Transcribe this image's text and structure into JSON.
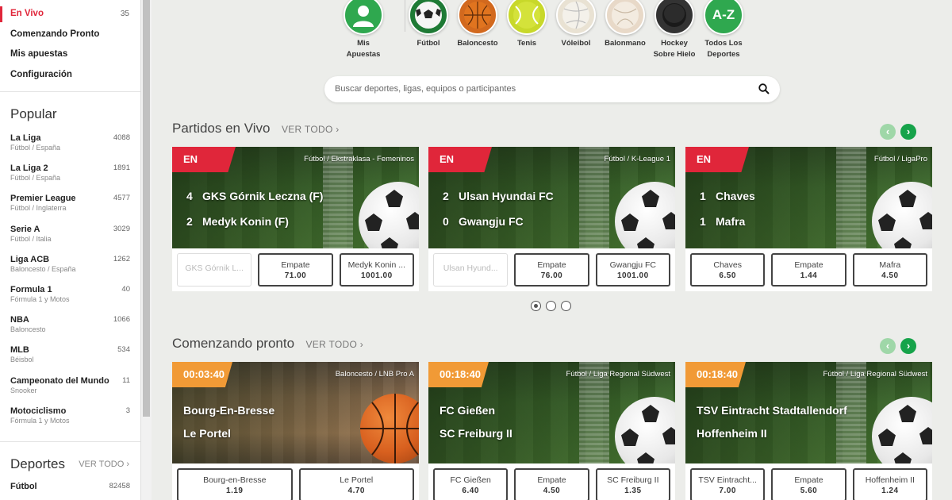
{
  "sidebar": {
    "nav": [
      {
        "label": "En Vivo",
        "count": "35",
        "active": true
      },
      {
        "label": "Comenzando Pronto",
        "count": ""
      },
      {
        "label": "Mis apuestas",
        "count": ""
      },
      {
        "label": "Configuración",
        "count": ""
      }
    ],
    "popular_title": "Popular",
    "popular": [
      {
        "name": "La Liga",
        "sub": "Fútbol / España",
        "count": "4088"
      },
      {
        "name": "La Liga 2",
        "sub": "Fútbol / España",
        "count": "1891"
      },
      {
        "name": "Premier League",
        "sub": "Fútbol / Inglaterra",
        "count": "4577"
      },
      {
        "name": "Serie A",
        "sub": "Fútbol / Italia",
        "count": "3029"
      },
      {
        "name": "Liga ACB",
        "sub": "Baloncesto / España",
        "count": "1262"
      },
      {
        "name": "Formula 1",
        "sub": "Fórmula 1 y Motos",
        "count": "40"
      },
      {
        "name": "NBA",
        "sub": "Baloncesto",
        "count": "1066"
      },
      {
        "name": "MLB",
        "sub": "Béisbol",
        "count": "534"
      },
      {
        "name": "Campeonato del Mundo",
        "sub": "Snooker",
        "count": "11"
      },
      {
        "name": "Motociclismo",
        "sub": "Fórmula 1 y Motos",
        "count": "3"
      }
    ],
    "deportes_title": "Deportes",
    "deportes_vertodo": "VER TODO",
    "deportes": [
      {
        "name": "Fútbol",
        "count": "82458"
      }
    ]
  },
  "sports_bar": [
    {
      "label1": "Mis",
      "label2": "Apuestas",
      "icon": "user-icon",
      "color": "#2fa84f"
    },
    {
      "label1": "Fútbol",
      "label2": "",
      "icon": "soccer-ball-icon",
      "color": "#1e7a35"
    },
    {
      "label1": "Baloncesto",
      "label2": "",
      "icon": "basketball-icon",
      "color": "#d2691e"
    },
    {
      "label1": "Tenis",
      "label2": "",
      "icon": "tennis-ball-icon",
      "color": "#c8d82a"
    },
    {
      "label1": "Vóleibol",
      "label2": "",
      "icon": "volleyball-icon",
      "color": "#e9e2d3"
    },
    {
      "label1": "Balonmano",
      "label2": "",
      "icon": "handball-icon",
      "color": "#e8d9c8"
    },
    {
      "label1": "Hockey",
      "label2": "Sobre Hielo",
      "icon": "hockey-puck-icon",
      "color": "#333333"
    },
    {
      "label1": "Todos Los",
      "label2": "Deportes",
      "icon": "a-z-icon",
      "icon_text": "A-Z",
      "color": "#2fa84f"
    }
  ],
  "search": {
    "placeholder": "Buscar deportes, ligas, equipos o participantes"
  },
  "live_section": {
    "title": "Partidos en Vivo",
    "vertodo": "VER TODO",
    "cards": [
      {
        "badge": "EN VIVO",
        "league": "Fútbol / Ekstraklasa - Femeninos",
        "team1": "GKS Górnik Leczna (F)",
        "score1": "4",
        "team2": "Medyk Konin (F)",
        "score2": "2",
        "odds": [
          {
            "label": "GKS Górnik L...",
            "value": "",
            "disabled": true
          },
          {
            "label": "Empate",
            "value": "71.00"
          },
          {
            "label": "Medyk Konin ...",
            "value": "1001.00"
          }
        ]
      },
      {
        "badge": "EN VIVO",
        "league": "Fútbol / K-League 1",
        "team1": "Ulsan Hyundai FC",
        "score1": "2",
        "team2": "Gwangju FC",
        "score2": "0",
        "odds": [
          {
            "label": "Ulsan Hyund...",
            "value": "",
            "disabled": true
          },
          {
            "label": "Empate",
            "value": "76.00"
          },
          {
            "label": "Gwangju FC",
            "value": "1001.00"
          }
        ]
      },
      {
        "badge": "EN VIVO",
        "league": "Fútbol / LigaPro",
        "team1": "Chaves",
        "score1": "1",
        "team2": "Mafra",
        "score2": "1",
        "odds": [
          {
            "label": "Chaves",
            "value": "6.50"
          },
          {
            "label": "Empate",
            "value": "1.44"
          },
          {
            "label": "Mafra",
            "value": "4.50"
          }
        ]
      }
    ]
  },
  "soon_section": {
    "title": "Comenzando pronto",
    "vertodo": "VER TODO",
    "cards": [
      {
        "badge": "00:03:40",
        "league": "Baloncesto / LNB Pro A",
        "team1": "Bourg-En-Bresse",
        "team2": "Le Portel",
        "odds": [
          {
            "label": "Bourg-en-Bresse",
            "value": "1.19"
          },
          {
            "label": "Le Portel",
            "value": "4.70"
          }
        ]
      },
      {
        "badge": "00:18:40",
        "league": "Fútbol / Liga Regional Südwest",
        "team1": "FC Gießen",
        "team2": "SC Freiburg II",
        "odds": [
          {
            "label": "FC Gießen",
            "value": "6.40"
          },
          {
            "label": "Empate",
            "value": "4.50"
          },
          {
            "label": "SC Freiburg II",
            "value": "1.35"
          }
        ]
      },
      {
        "badge": "00:18:40",
        "league": "Fútbol / Liga Regional Südwest",
        "team1": "TSV Eintracht Stadtallendorf",
        "team2": "Hoffenheim II",
        "odds": [
          {
            "label": "TSV Eintracht...",
            "value": "7.00"
          },
          {
            "label": "Empate",
            "value": "5.60"
          },
          {
            "label": "Hoffenheim II",
            "value": "1.24"
          }
        ]
      }
    ]
  },
  "colors": {
    "live": "#e0263a",
    "countdown": "#f19a36",
    "accent_green": "#16a34a"
  }
}
